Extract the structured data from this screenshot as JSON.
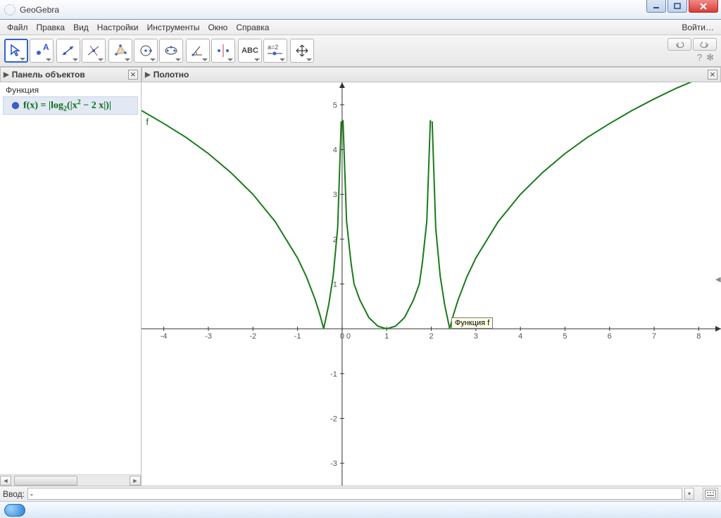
{
  "window": {
    "title": "GeoGebra"
  },
  "menu": {
    "items": [
      "Файл",
      "Правка",
      "Вид",
      "Настройки",
      "Инструменты",
      "Окно",
      "Справка"
    ],
    "login": "Войти…"
  },
  "toolbar": {
    "text_tool": "ABC",
    "slider_tool": "a=2",
    "help_symbol": "?",
    "pref_symbol": "✻"
  },
  "panels": {
    "left_title": "Панель объектов",
    "right_title": "Полотно"
  },
  "objects": {
    "category": "Функция",
    "item_name": "f(x)",
    "item_eq": " = ",
    "log_base": "2",
    "inner": "x",
    "inner_exp": "2",
    "inner_tail": " − 2 x"
  },
  "graph": {
    "curve_label": "f",
    "tooltip": "Функция f"
  },
  "input": {
    "label": "Ввод:",
    "value": "-"
  },
  "chart_data": {
    "type": "line",
    "title": "",
    "xlabel": "",
    "ylabel": "",
    "xlim": [
      -4.5,
      8.5
    ],
    "ylim": [
      -3.5,
      5.5
    ],
    "x_ticks": [
      -4,
      -3,
      -2,
      -1,
      0,
      1,
      2,
      3,
      4,
      5,
      6,
      7,
      8
    ],
    "y_ticks": [
      -3,
      -2,
      -1,
      0,
      1,
      2,
      3,
      4,
      5
    ],
    "function": "f(x) = | log2( | x^2 - 2x | ) |",
    "asymptotes_x": [
      0,
      2
    ],
    "zeros_x": [
      -0.414,
      0.268,
      1,
      1.732,
      2.414
    ],
    "series": [
      {
        "name": "f",
        "color": "#1a7a1a",
        "x": [
          -4.5,
          -4,
          -3.5,
          -3,
          -2.5,
          -2,
          -1.5,
          -1,
          -0.8,
          -0.6,
          -0.5,
          -0.414,
          -0.3,
          -0.2,
          -0.1,
          -0.02,
          0.02,
          0.1,
          0.2,
          0.268,
          0.4,
          0.6,
          0.8,
          1.0,
          1.2,
          1.4,
          1.6,
          1.732,
          1.8,
          1.9,
          1.98,
          2.02,
          2.1,
          2.2,
          2.3,
          2.414,
          2.5,
          2.6,
          2.8,
          3.0,
          3.5,
          4.0,
          4.5,
          5.0,
          5.5,
          6.0,
          6.5,
          7.0,
          7.5,
          8.0,
          8.5
        ],
        "y": [
          4.87,
          4.58,
          4.27,
          3.91,
          3.49,
          3.0,
          2.39,
          1.58,
          1.16,
          0.64,
          0.32,
          0.0,
          0.54,
          1.18,
          2.25,
          4.63,
          4.66,
          2.4,
          1.47,
          1.0,
          0.64,
          0.25,
          0.06,
          0.0,
          0.06,
          0.25,
          0.64,
          1.0,
          1.47,
          2.4,
          4.66,
          4.63,
          2.25,
          1.18,
          0.54,
          0.0,
          0.32,
          0.64,
          1.16,
          1.58,
          2.39,
          3.0,
          3.49,
          3.91,
          4.27,
          4.58,
          4.87,
          5.13,
          5.37,
          5.58,
          5.79
        ]
      }
    ]
  }
}
